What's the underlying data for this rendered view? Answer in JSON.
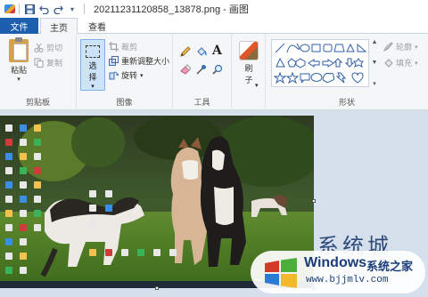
{
  "window": {
    "title": "20211231120858_13878.png - 画图"
  },
  "tabs": {
    "file": "文件",
    "home": "主页",
    "view": "查看"
  },
  "clipboard": {
    "paste": "粘贴",
    "cut": "剪切",
    "copy": "复制",
    "group_label": "剪贴板"
  },
  "image": {
    "select": "选",
    "select2": "择",
    "crop": "裁剪",
    "resize": "重新调整大小",
    "rotate": "旋转",
    "group_label": "图像"
  },
  "tools": {
    "group_label": "工具"
  },
  "brushes": {
    "label": "刷",
    "label2": "子"
  },
  "shapes": {
    "outline": "轮廓",
    "fill": "填充",
    "group_label": "形状"
  },
  "watermark": {
    "big_text": "系统城",
    "brand": "Windows",
    "brand_cn": "系统之家",
    "url": "www.bjjmlv.com"
  },
  "colors": {
    "file_tab": "#1c5fae",
    "ribbon_bg": "#f5f6f7",
    "workspace_bg": "#d6dfec"
  }
}
